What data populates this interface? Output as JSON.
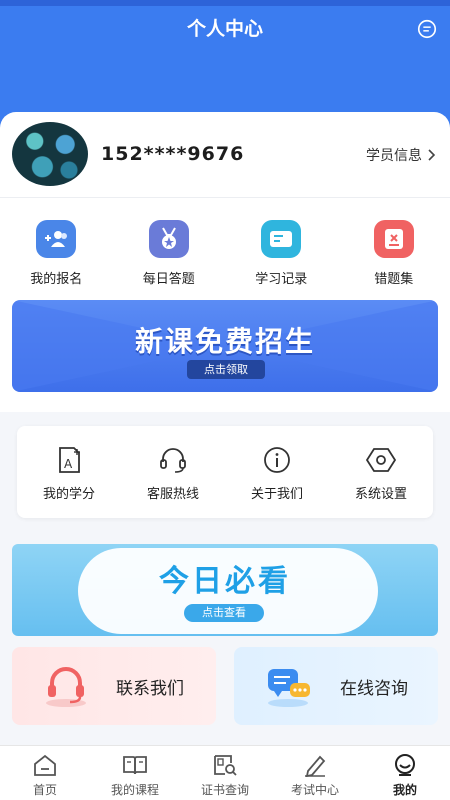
{
  "header": {
    "title": "个人中心"
  },
  "profile": {
    "phone": "152****9676",
    "student_info": "学员信息"
  },
  "quick_actions": [
    {
      "label": "我的报名",
      "icon": "registration-icon",
      "color": "#4a86e8"
    },
    {
      "label": "每日答题",
      "icon": "medal-icon",
      "color": "#6a7bd8"
    },
    {
      "label": "学习记录",
      "icon": "record-icon",
      "color": "#2fb5de"
    },
    {
      "label": "错题集",
      "icon": "wrong-questions-icon",
      "color": "#f06262"
    }
  ],
  "banner_new_course": {
    "title": "新课免费招生",
    "button": "点击领取"
  },
  "tools": [
    {
      "label": "我的学分",
      "icon": "credit-icon"
    },
    {
      "label": "客服热线",
      "icon": "headset-icon"
    },
    {
      "label": "关于我们",
      "icon": "info-icon"
    },
    {
      "label": "系统设置",
      "icon": "settings-icon"
    }
  ],
  "banner_today": {
    "title": "今日必看",
    "button": "点击查看"
  },
  "contacts": [
    {
      "label": "联系我们",
      "icon": "contact-headset-icon"
    },
    {
      "label": "在线咨询",
      "icon": "chat-bubble-icon"
    }
  ],
  "tabbar": [
    {
      "label": "首页",
      "icon": "home-icon"
    },
    {
      "label": "我的课程",
      "icon": "book-icon"
    },
    {
      "label": "证书查询",
      "icon": "certificate-search-icon"
    },
    {
      "label": "考试中心",
      "icon": "pen-icon"
    },
    {
      "label": "我的",
      "icon": "user-icon",
      "active": true
    }
  ],
  "colors": {
    "primary": "#3b7cf0",
    "accent_red": "#f06262"
  }
}
